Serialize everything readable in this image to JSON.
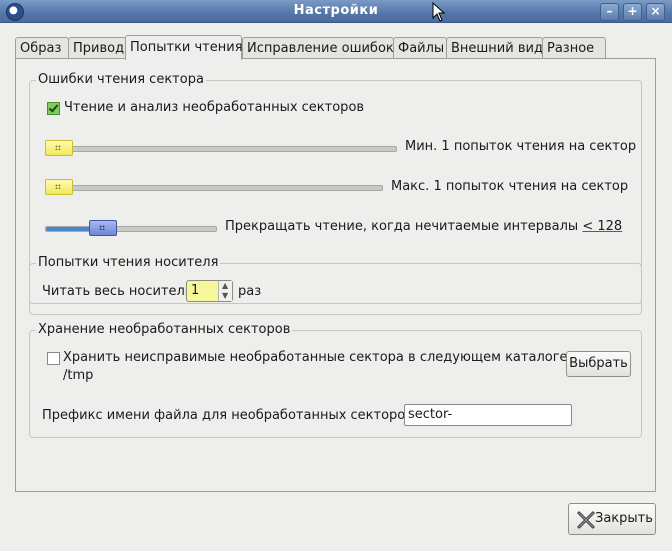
{
  "window": {
    "title": "Настройки"
  },
  "tabs": [
    {
      "label": "Образ"
    },
    {
      "label": "Привод"
    },
    {
      "label": "Попытки чтения"
    },
    {
      "label": "Исправление ошибок"
    },
    {
      "label": "Файлы"
    },
    {
      "label": "Внешний вид"
    },
    {
      "label": "Разное"
    }
  ],
  "active_tab_index": 2,
  "sector_errors": {
    "title": "Ошибки чтения сектора",
    "raw_analysis_label": "Чтение и анализ необработанных секторов",
    "raw_analysis_checked": true,
    "min_label": "Мин. 1 попыток чтения на сектор",
    "max_label": "Макс. 1 попыток чтения на сектор",
    "stop_label": "Прекращать чтение, когда нечитаемые интервалы",
    "stop_value": "< 128"
  },
  "media_attempts": {
    "title": "Попытки чтения носителя",
    "read_label": "Читать весь носитель",
    "read_value": "1",
    "times_label": "раз"
  },
  "raw_storage": {
    "title": "Хранение необработанных секторов",
    "store_label": "Хранить неисправимые необработанные сектора в следующем каталоге:",
    "store_checked": false,
    "directory": "/tmp",
    "choose_button": "Выбрать",
    "prefix_label": "Префикс имени файла для необработанных секторов:",
    "prefix_value": "sector-"
  },
  "footer": {
    "close_button": "Закрыть"
  },
  "colors": {
    "titlebar": "#5476a8",
    "accent": "#4a86d0",
    "highlight": "#f7f79a"
  }
}
